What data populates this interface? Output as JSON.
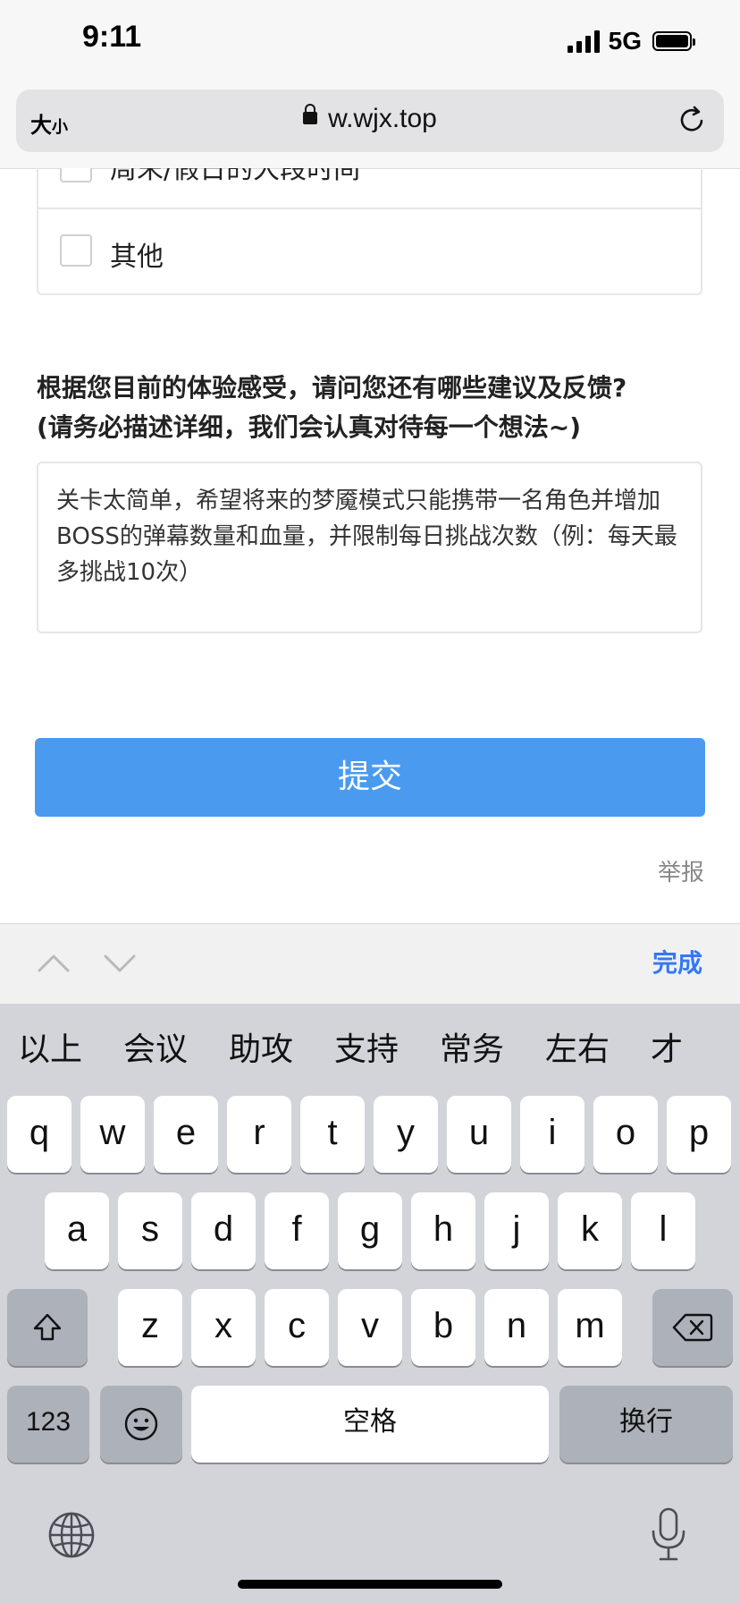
{
  "status_bar": {
    "time": "9:11",
    "network": "5G"
  },
  "browser": {
    "text_size": "大",
    "text_size_small": "小",
    "url": "w.wjx.top"
  },
  "survey": {
    "options": [
      {
        "label": "周末/假日的大段时间",
        "checked": false
      },
      {
        "label": "其他",
        "checked": false
      }
    ],
    "question_line1": "根据您目前的体验感受，请问您还有哪些建议及反馈?",
    "question_line2": "(请务必描述详细，我们会认真对待每一个想法~)",
    "answer": "关卡太简单，希望将来的梦魇模式只能携带一名角色并增加BOSS的弹幕数量和血量，并限制每日挑战次数（例：每天最多挑战10次）",
    "submit_label": "提交",
    "report_label": "举报"
  },
  "keyboard_toolbar": {
    "done_label": "完成"
  },
  "keyboard": {
    "suggestions": [
      "以上",
      "会议",
      "助攻",
      "支持",
      "常务",
      "左右",
      "才"
    ],
    "row1": [
      "q",
      "w",
      "e",
      "r",
      "t",
      "y",
      "u",
      "i",
      "o",
      "p"
    ],
    "row2": [
      "a",
      "s",
      "d",
      "f",
      "g",
      "h",
      "j",
      "k",
      "l"
    ],
    "row3": [
      "z",
      "x",
      "c",
      "v",
      "b",
      "n",
      "m"
    ],
    "numbers_label": "123",
    "space_label": "空格",
    "return_label": "换行"
  }
}
